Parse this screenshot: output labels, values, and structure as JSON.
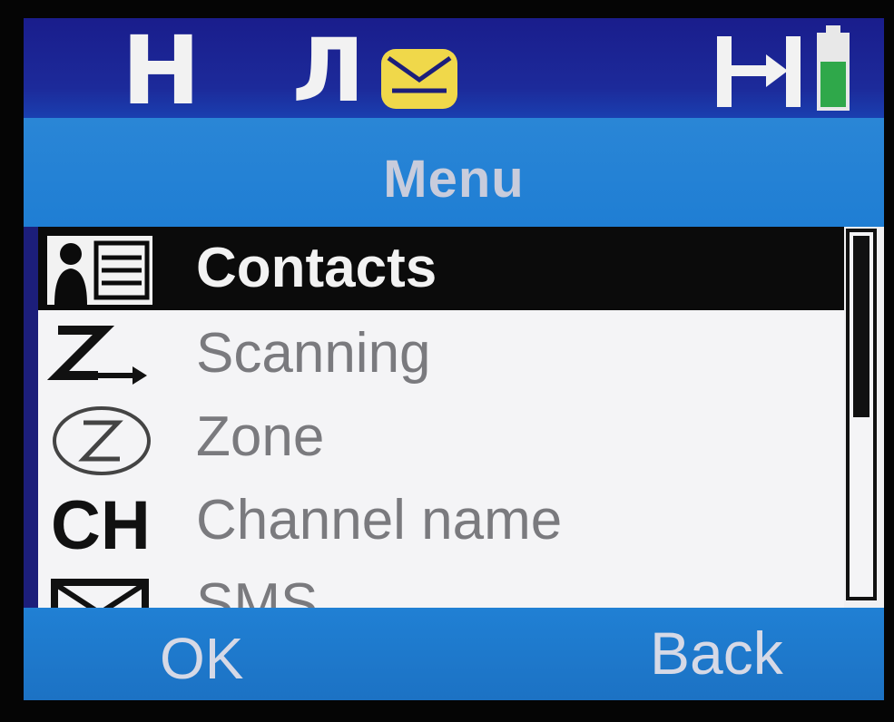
{
  "status_bar": {
    "mode_indicator": "H",
    "signal_indicator": "Л",
    "icons": [
      "envelope-icon",
      "signal-icon",
      "battery-icon"
    ],
    "envelope_color": "#f0d84a",
    "battery_color": "#2fa84a"
  },
  "header": {
    "title": "Menu"
  },
  "menu": {
    "items": [
      {
        "label": "Contacts",
        "icon": "contacts-icon",
        "selected": true
      },
      {
        "label": "Scanning",
        "icon": "scanning-icon",
        "selected": false
      },
      {
        "label": "Zone",
        "icon": "zone-icon",
        "selected": false
      },
      {
        "label": "Channel name",
        "icon": "channel-icon",
        "icon_text": "CH",
        "selected": false
      },
      {
        "label": "SMS",
        "icon": "sms-icon",
        "selected": false
      }
    ]
  },
  "softkeys": {
    "left_label": "OK",
    "right_label": "Back"
  },
  "colors": {
    "status_bg": "#1c1e8c",
    "title_bg": "#2a86d6",
    "softkey_bg": "#2080d4",
    "list_bg": "#f4f4f6",
    "selected_bg": "#0b0b0b"
  }
}
